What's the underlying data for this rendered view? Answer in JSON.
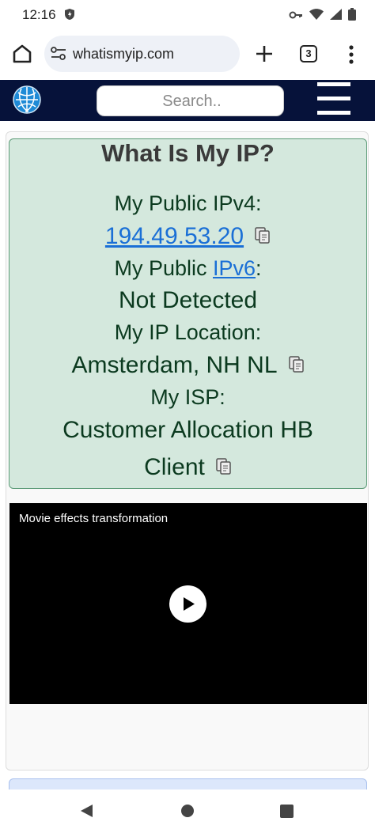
{
  "status": {
    "time": "12:16"
  },
  "browser": {
    "url": "whatismyip.com",
    "tab_count": "3"
  },
  "site": {
    "search_placeholder": "Search.."
  },
  "info": {
    "title": "What Is My IP?",
    "ipv4_label": "My Public IPv4:",
    "ipv4_value": "194.49.53.20",
    "ipv6_label_prefix": "My Public ",
    "ipv6_link": "IPv6",
    "ipv6_label_suffix": ":",
    "ipv6_value": "Not Detected",
    "location_label": "My IP Location:",
    "location_value": "Amsterdam, NH NL",
    "isp_label": "My ISP:",
    "isp_value_line1": "Customer Allocation HB",
    "isp_value_line2": "Client"
  },
  "video": {
    "title": "Movie effects transformation"
  },
  "colors": {
    "header_bg": "#06123a",
    "card_bg": "#d4e8dd",
    "link": "#1a6fd6",
    "text_green": "#0b3a1f"
  }
}
